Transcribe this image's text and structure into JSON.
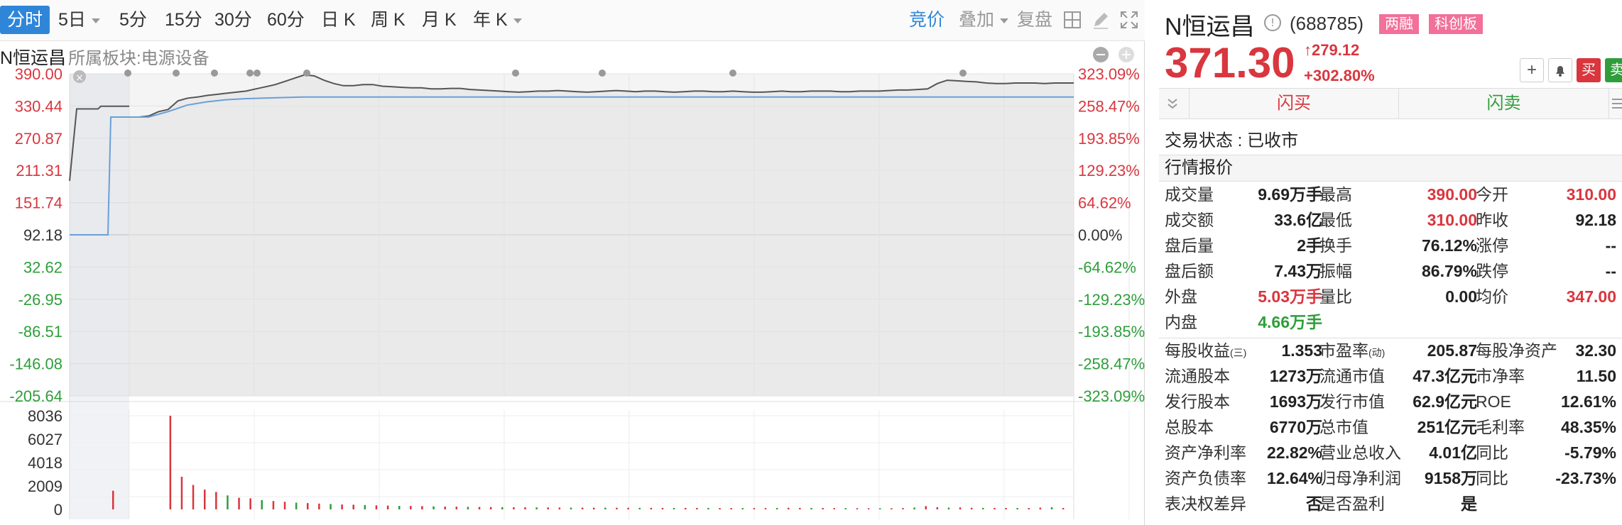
{
  "toolbar": {
    "tabs": [
      "分时",
      "5日",
      "5分",
      "15分",
      "30分",
      "60分",
      "日 K",
      "周 K",
      "月 K",
      "年 K"
    ],
    "active_tab": "分时",
    "bid_label": "竞价",
    "overlay_label": "叠加",
    "restore_label": "复盘"
  },
  "subheader": {
    "name": "N恒运昌",
    "sector": "所属板块:电源设备"
  },
  "chart_data": {
    "type": "line",
    "price_axis": {
      "ticks": [
        390.0,
        330.44,
        270.87,
        211.31,
        151.74,
        92.18,
        32.62,
        -26.95,
        -86.51,
        -146.08,
        -205.64
      ],
      "tick_labels": [
        "390.00",
        "330.44",
        "270.87",
        "211.31",
        "151.74",
        "92.18",
        "32.62",
        "-26.95",
        "-86.51",
        "-146.08",
        "-205.64"
      ],
      "ylim": [
        -205.64,
        390.0
      ],
      "prev_close": 92.18
    },
    "pct_axis": {
      "tick_labels": [
        "323.09%",
        "258.47%",
        "193.85%",
        "129.23%",
        "64.62%",
        "0.00%",
        "-64.62%",
        "-129.23%",
        "-193.85%",
        "-258.47%",
        "-323.09%"
      ]
    },
    "volume_axis": {
      "tick_labels": [
        "8036",
        "6027",
        "4018",
        "2009",
        "0"
      ],
      "ticks": [
        8036,
        6027,
        4018,
        2009,
        0
      ],
      "ylim": [
        0,
        8036
      ]
    },
    "price_series": [
      310,
      310,
      312,
      320,
      324,
      340,
      345,
      347,
      350,
      352,
      354,
      356,
      358,
      362,
      366,
      370,
      376,
      382,
      388,
      386,
      378,
      372,
      368,
      368,
      370,
      370,
      367,
      366,
      365,
      364,
      364,
      362,
      362,
      363,
      363,
      361,
      360,
      359,
      358,
      357,
      356,
      357,
      358,
      358,
      359,
      358,
      357,
      356,
      357,
      358,
      359,
      358,
      357,
      358,
      358,
      357,
      356,
      357,
      358,
      358,
      357,
      357,
      358,
      357,
      356,
      356,
      357,
      358,
      357,
      357,
      358,
      358,
      358,
      357,
      357,
      358,
      358,
      358,
      359,
      360,
      360,
      361,
      362,
      372,
      378,
      377,
      376,
      375,
      373,
      372,
      372,
      373,
      373,
      373,
      372,
      373,
      373,
      373
    ],
    "avg_series": [
      310,
      310,
      320,
      332,
      338,
      342,
      344,
      345,
      346,
      347,
      347,
      347,
      347,
      347,
      347,
      347,
      347,
      347,
      347,
      347,
      347,
      347,
      347,
      347,
      347,
      347,
      347,
      347,
      347,
      347,
      347,
      347,
      347,
      347,
      347,
      347,
      347,
      347,
      347,
      347,
      347,
      347,
      347,
      347,
      347,
      347,
      347,
      347,
      347,
      347
    ],
    "volume_series": [
      1600,
      0,
      0,
      0,
      0,
      8036,
      2800,
      2100,
      1700,
      1500,
      1200,
      1000,
      950,
      800,
      720,
      650,
      580,
      540,
      500,
      460,
      420,
      400,
      380,
      350,
      330,
      300,
      290,
      280,
      260,
      240,
      230,
      220,
      210,
      200,
      190,
      180,
      175,
      170,
      165,
      160,
      155,
      150,
      148,
      145,
      140,
      138,
      135,
      132,
      130,
      128,
      125,
      122,
      120,
      118,
      116,
      114,
      112,
      110,
      120,
      140,
      130,
      125,
      118,
      112,
      108,
      104,
      100,
      98,
      96,
      110,
      160,
      280,
      190,
      150,
      170,
      140,
      130,
      125,
      122,
      120,
      118,
      150,
      180,
      120
    ]
  },
  "quote": {
    "name": "N恒运昌",
    "code": "(688785)",
    "badge1": "两融",
    "badge2": "科创板",
    "price": "371.30",
    "change": "279.12",
    "change_pct": "+302.80%",
    "btn_buy": "买",
    "btn_sell": "卖",
    "flash_buy": "闪买",
    "flash_sell": "闪卖",
    "status": "交易状态 : 已收市",
    "quote_title": "行情报价",
    "colors": {
      "up": "#d9363e",
      "down": "#2e9e3a",
      "accent": "#2f86d9"
    },
    "rows": [
      [
        "成交量",
        "9.69万手",
        "最高",
        "390.00",
        "今开",
        "310.00"
      ],
      [
        "成交额",
        "33.6亿",
        "最低",
        "310.00",
        "昨收",
        "92.18"
      ],
      [
        "盘后量",
        "2手",
        "换手",
        "76.12%",
        "涨停",
        "--"
      ],
      [
        "盘后额",
        "7.43万",
        "振幅",
        "86.79%",
        "跌停",
        "--"
      ],
      [
        "外盘",
        "5.03万手",
        "量比",
        "0.00",
        "均价",
        "347.00"
      ],
      [
        "内盘",
        "4.66万手",
        "",
        "",
        "",
        ""
      ]
    ],
    "fundamentals": [
      [
        "每股收益",
        "(三)",
        "1.353",
        "市盈率",
        "(动)",
        "205.87",
        "每股净资产",
        "32.30"
      ],
      [
        "流通股本",
        "",
        "1273万",
        "流通市值",
        "",
        "47.3亿元",
        "市净率",
        "11.50"
      ],
      [
        "发行股本",
        "",
        "1693万",
        "发行市值",
        "",
        "62.9亿元",
        "ROE",
        "12.61%"
      ],
      [
        "总股本",
        "",
        "6770万",
        "总市值",
        "",
        "251亿元",
        "毛利率",
        "48.35%"
      ],
      [
        "资产净利率",
        "",
        "22.82%",
        "营业总收入",
        "",
        "4.01亿",
        "同比",
        "-5.79%"
      ],
      [
        "资产负债率",
        "",
        "12.64%",
        "归母净利润",
        "",
        "9158万",
        "同比",
        "-23.73%"
      ],
      [
        "表决权差异",
        "",
        "否",
        "是否盈利",
        "",
        "是",
        "",
        ""
      ]
    ]
  }
}
